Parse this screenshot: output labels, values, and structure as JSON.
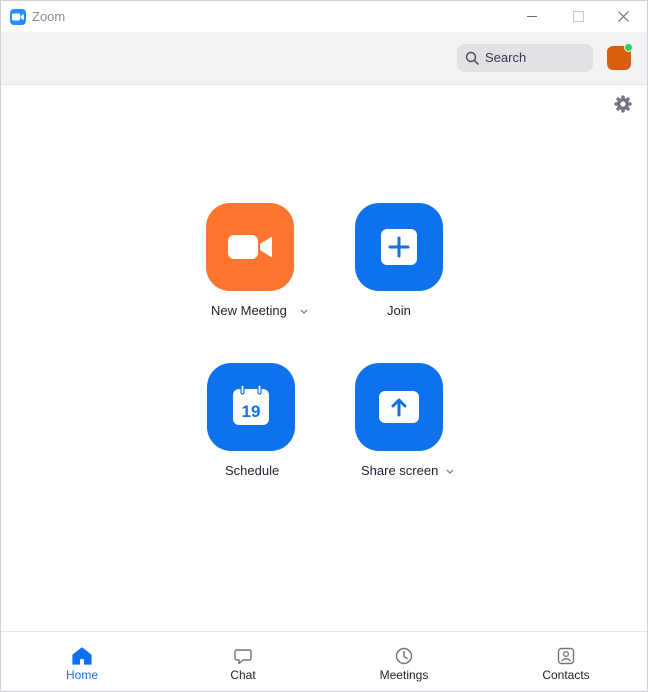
{
  "window": {
    "title": "Zoom"
  },
  "header": {
    "search_label": "Search"
  },
  "actions": [
    {
      "label": "New Meeting",
      "icon": "video-camera-icon",
      "color": "#ff742e",
      "has_dropdown": true
    },
    {
      "label": "Join",
      "icon": "plus-icon",
      "color": "#0e72ed",
      "has_dropdown": false
    },
    {
      "label": "Schedule",
      "icon": "calendar-icon",
      "color": "#0e72ed",
      "has_dropdown": false,
      "calendar_day": "19"
    },
    {
      "label": "Share screen",
      "icon": "share-arrow-icon",
      "color": "#0e72ed",
      "has_dropdown": true
    }
  ],
  "nav": {
    "items": [
      {
        "label": "Home",
        "icon": "home-icon",
        "active": true
      },
      {
        "label": "Chat",
        "icon": "chat-icon",
        "active": false
      },
      {
        "label": "Meetings",
        "icon": "clock-icon",
        "active": false
      },
      {
        "label": "Contacts",
        "icon": "contacts-icon",
        "active": false
      }
    ]
  },
  "colors": {
    "accent": "#0e72ed",
    "new_meeting": "#ff742e",
    "avatar": "#d95f0e",
    "presence": "#23d959"
  }
}
